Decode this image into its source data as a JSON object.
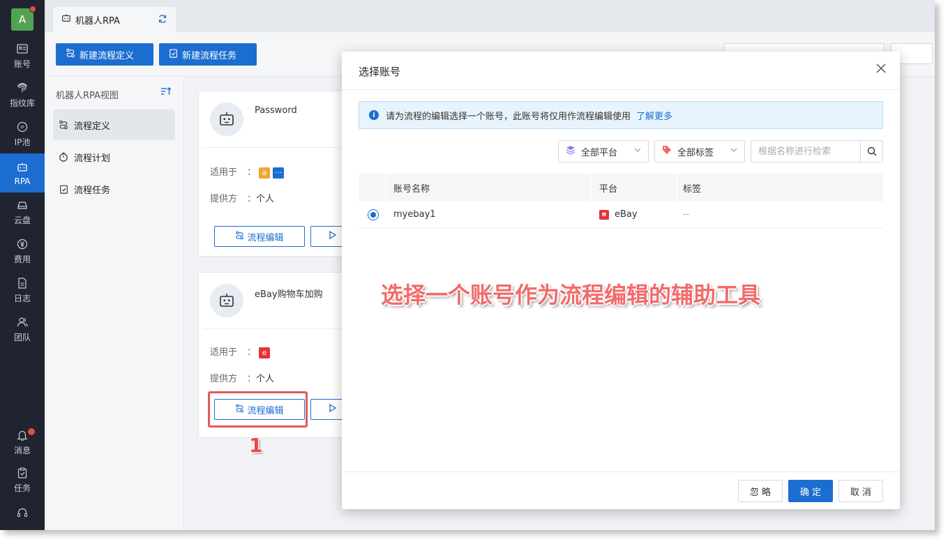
{
  "sidebar": {
    "avatar": "A",
    "items": [
      {
        "label": "账号"
      },
      {
        "label": "指纹库"
      },
      {
        "label": "IP池"
      },
      {
        "label": "RPA"
      },
      {
        "label": "云盘"
      },
      {
        "label": "费用"
      },
      {
        "label": "日志"
      },
      {
        "label": "团队"
      },
      {
        "label": "消息"
      },
      {
        "label": "任务"
      }
    ]
  },
  "tab": {
    "label": "机器人RPA"
  },
  "toolbar": {
    "new_definition": "新建流程定义",
    "new_task": "新建流程任务"
  },
  "left_panel": {
    "title": "机器人RPA视图",
    "items": [
      {
        "label": "流程定义"
      },
      {
        "label": "流程计划"
      },
      {
        "label": "流程任务"
      }
    ]
  },
  "cards": [
    {
      "title": "Password",
      "applies_label": "适用于",
      "provider_label": "提供方",
      "provider_value": "个人",
      "edit_label": "流程编辑"
    },
    {
      "title": "eBay购物车加购",
      "applies_label": "适用于",
      "provider_label": "提供方",
      "provider_value": "个人",
      "edit_label": "流程编辑"
    }
  ],
  "step_number": "1",
  "modal": {
    "title": "选择账号",
    "info_text": "请为流程的编辑选择一个账号，此账号将仅用作流程编辑使用",
    "info_link": "了解更多",
    "platform_filter": "全部平台",
    "tag_filter": "全部标签",
    "search_placeholder": "根据名称进行检索",
    "columns": {
      "name": "账号名称",
      "platform": "平台",
      "tags": "标签"
    },
    "rows": [
      {
        "name": "myebay1",
        "platform": "eBay",
        "tags": "--"
      }
    ],
    "annotation": "选择一个账号作为流程编辑的辅助工具",
    "ignore": "忽 略",
    "confirm": "确 定",
    "cancel": "取 消"
  },
  "colors": {
    "primary": "#1c6dd0",
    "sidebar": "#1f2430",
    "annotation": "#f26b6b",
    "ebay": "#e53238"
  }
}
